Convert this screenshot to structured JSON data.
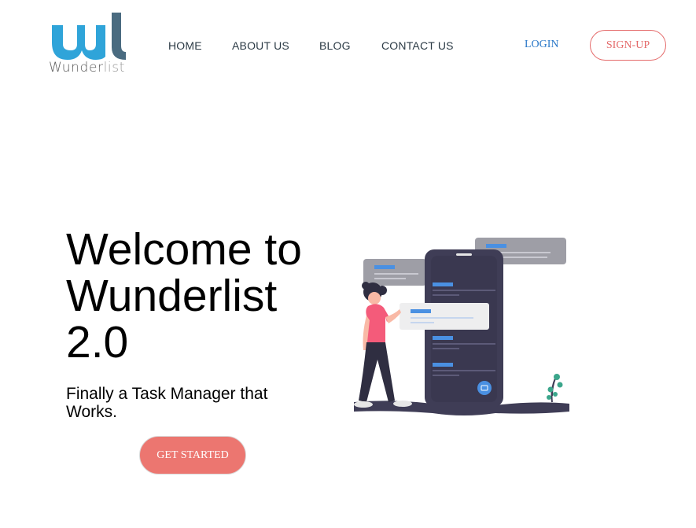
{
  "brand": {
    "logo_mark": "wl-logo-mark",
    "name_part1": "Wunder",
    "name_part2": "list",
    "colors": {
      "primary_blue": "#2fa4d9",
      "dark_slate": "#4a6b80"
    }
  },
  "nav": {
    "items": [
      {
        "label": "HOME"
      },
      {
        "label": "ABOUT US"
      },
      {
        "label": "BLOG"
      },
      {
        "label": "CONTACT US"
      }
    ]
  },
  "auth": {
    "login_label": "LOGIN",
    "signup_label": "SIGN-UP"
  },
  "hero": {
    "title": "Welcome to Wunderlist 2.0",
    "subtitle": "Finally a Task Manager that Works.",
    "cta_label": "GET STARTED",
    "illustration": "person-with-phone-task-list-illustration"
  },
  "colors": {
    "accent_red": "#ec7670",
    "link_blue": "#2a78c8",
    "phone_dark": "#3f3d56",
    "bubble_gray": "#9e9ea6",
    "task_blue": "#4a90e2"
  }
}
